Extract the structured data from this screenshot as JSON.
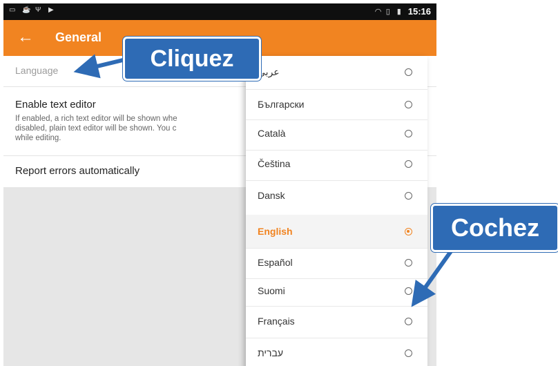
{
  "status_bar": {
    "left_icons": [
      "image-icon",
      "coffee-icon",
      "usb-icon",
      "play-icon"
    ],
    "right_icons": [
      "wifi-icon",
      "no-sim-icon",
      "battery-icon"
    ],
    "time": "15:16"
  },
  "app_bar": {
    "title": "General",
    "back_icon": "arrow-left-icon",
    "color": "#f18421"
  },
  "settings": {
    "language_label": "Language",
    "editor_title": "Enable text editor",
    "editor_description": "If enabled, a rich text editor will be shown whe\ndisabled, plain text editor will be shown. You c\nwhile editing.",
    "report_label": "Report errors automatically"
  },
  "language_menu": {
    "items": [
      {
        "label": "عربي",
        "selected": false
      },
      {
        "label": "Български",
        "selected": false
      },
      {
        "label": "Català",
        "selected": false
      },
      {
        "label": "Čeština",
        "selected": false
      },
      {
        "label": "Dansk",
        "selected": false
      },
      {
        "label": "English",
        "selected": true
      },
      {
        "label": "Español",
        "selected": false
      },
      {
        "label": "Suomi",
        "selected": false
      },
      {
        "label": "Français",
        "selected": false
      },
      {
        "label": "עברית",
        "selected": false
      }
    ]
  },
  "annotations": {
    "click_label": "Cliquez",
    "check_label": "Cochez",
    "color": "#2e6bb5"
  }
}
